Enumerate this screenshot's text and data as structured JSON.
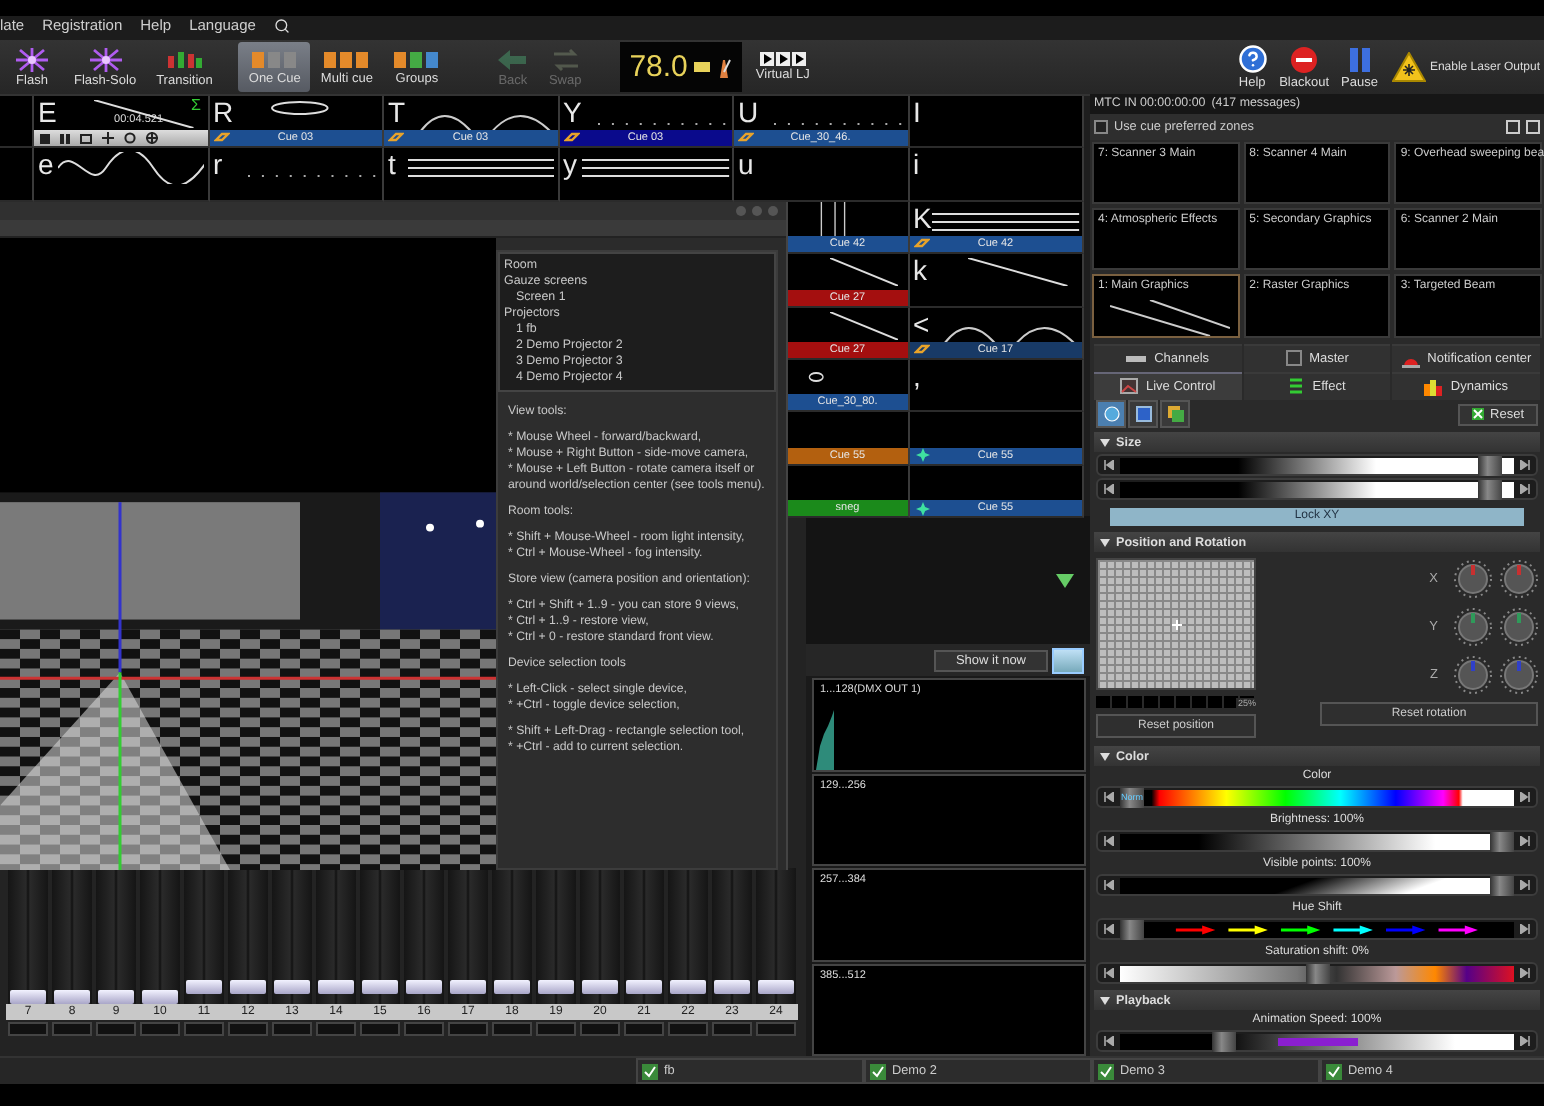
{
  "menu": [
    "late",
    "Registration",
    "Help",
    "Language"
  ],
  "toolbar": {
    "left": [
      {
        "label": "Flash",
        "kind": "flash",
        "selected": false,
        "disabled": false
      },
      {
        "label": "Flash-Solo",
        "kind": "flash-solo",
        "selected": false,
        "disabled": false
      },
      {
        "label": "Transition",
        "kind": "transition",
        "selected": false,
        "disabled": false
      },
      {
        "label": "One Cue",
        "kind": "one-cue",
        "selected": true,
        "disabled": false
      },
      {
        "label": "Multi cue",
        "kind": "multi-cue",
        "selected": false,
        "disabled": false
      },
      {
        "label": "Groups",
        "kind": "groups",
        "selected": false,
        "disabled": false
      },
      {
        "label": "Back",
        "kind": "back",
        "selected": false,
        "disabled": true
      },
      {
        "label": "Swap",
        "kind": "swap",
        "selected": false,
        "disabled": true
      }
    ],
    "bpm": "78.0",
    "virtual_lj": "Virtual LJ",
    "right": [
      {
        "label": "Help",
        "kind": "help"
      },
      {
        "label": "Blackout",
        "kind": "blackout"
      },
      {
        "label": "Pause",
        "kind": "pause"
      },
      {
        "label": "Enable Laser Output",
        "kind": "laser"
      }
    ]
  },
  "cue_rows": [
    {
      "cells": [
        {
          "kind": "none"
        },
        {
          "key": "E",
          "kind": "line",
          "playing": true,
          "time": "00:04.521",
          "sigma": "Σ"
        },
        {
          "key": "R",
          "kind": "ellipse",
          "cue": "Cue 03",
          "color": "#1d4f91",
          "linked": true
        },
        {
          "key": "T",
          "kind": "arc",
          "cue": "Cue 03",
          "color": "#1d4f91",
          "linked": true
        },
        {
          "key": "Y",
          "kind": "dots",
          "cue": "Cue 03",
          "color": "#0a0a8c",
          "linked": true
        },
        {
          "key": "U",
          "kind": "dots",
          "cue": "Cue_30_46.",
          "color": "#1d4f91",
          "linked": true
        },
        {
          "key": "I",
          "kind": "none"
        }
      ]
    },
    {
      "cells": [
        {
          "kind": "none"
        },
        {
          "key": "e",
          "kind": "wave"
        },
        {
          "key": "r",
          "kind": "dots"
        },
        {
          "key": "t",
          "kind": "lines"
        },
        {
          "key": "y",
          "kind": "lines"
        },
        {
          "key": "u",
          "kind": "none"
        },
        {
          "key": "i",
          "kind": "none"
        }
      ]
    },
    {
      "cells": [
        {
          "kind": "vlines",
          "cue": "Cue 42",
          "color": "#1d4f91"
        },
        {
          "key": "K",
          "kind": "lines",
          "cue": "Cue 42",
          "color": "#1d4f91",
          "linked": true
        }
      ]
    },
    {
      "cells": [
        {
          "kind": "line",
          "cue": "Cue 27",
          "color": "#a40f0f"
        },
        {
          "key": "k",
          "kind": "line"
        }
      ]
    },
    {
      "cells": [
        {
          "kind": "line",
          "cue": "Cue 27",
          "color": "#a40f0f"
        },
        {
          "key": "<",
          "kind": "arc",
          "cue": "Cue 17",
          "color": "#183a66",
          "linked": true
        }
      ]
    },
    {
      "cells": [
        {
          "kind": "spot",
          "cue": "Cue_30_80.",
          "color": "#1d4f91"
        },
        {
          "key": ",",
          "kind": "none"
        }
      ]
    },
    {
      "cells": [
        {
          "kind": "none",
          "cue": "Cue 55",
          "color": "#b3600f"
        },
        {
          "kind": "none",
          "cue": "Cue 55",
          "color": "#1d4f91",
          "starred": true
        }
      ]
    },
    {
      "cells": [
        {
          "kind": "none",
          "cue": "sneg",
          "color": "#1b8a1b"
        },
        {
          "kind": "none",
          "cue": "Cue 55",
          "color": "#1d4f91",
          "starred": true
        }
      ]
    }
  ],
  "visualizer": {
    "tree": [
      {
        "label": "Room"
      },
      {
        "label": "Gauze screens",
        "children": [
          {
            "label": "Screen 1"
          }
        ]
      },
      {
        "label": "Projectors",
        "children": [
          {
            "label": "1 fb"
          },
          {
            "label": "2 Demo Projector 2"
          },
          {
            "label": "3 Demo Projector 3"
          },
          {
            "label": "4 Demo Projector 4"
          }
        ]
      }
    ],
    "help": [
      {
        "kind": "heading",
        "text": "View tools:"
      },
      {
        "kind": "list",
        "lines": [
          "* Mouse Wheel - forward/backward,",
          "* Mouse + Right Button - side-move camera,",
          "* Mouse + Left Button - rotate camera itself or around world/selection center (see tools menu)."
        ]
      },
      {
        "kind": "heading",
        "text": "Room tools:"
      },
      {
        "kind": "list",
        "lines": [
          "* Shift + Mouse-Wheel - room light intensity,",
          "* Ctrl + Mouse-Wheel - fog intensity."
        ]
      },
      {
        "kind": "heading",
        "text": "Store view (camera position and orientation):"
      },
      {
        "kind": "list",
        "lines": [
          "* Ctrl + Shift + 1..9 - you can store 9 views,",
          "* Ctrl + 1..9 - restore view,",
          "* Ctrl + 0 - restore standard front view."
        ]
      },
      {
        "kind": "heading",
        "text": "Device selection tools"
      },
      {
        "kind": "list",
        "lines": [
          "* Left-Click - select single device,",
          "* +Ctrl - toggle device selection,"
        ]
      },
      {
        "kind": "list",
        "lines": [
          "* Shift + Left-Drag - rectangle selection tool,",
          "* +Ctrl - add to current selection."
        ]
      }
    ]
  },
  "faders": [
    {
      "label": "7",
      "level": 0
    },
    {
      "label": "8",
      "level": 0
    },
    {
      "label": "9",
      "level": 0
    },
    {
      "label": "10",
      "level": 0
    },
    {
      "label": "11",
      "level": 0.08
    },
    {
      "label": "12",
      "level": 0.08
    },
    {
      "label": "13",
      "level": 0.08
    },
    {
      "label": "14",
      "level": 0.08
    },
    {
      "label": "15",
      "level": 0.08
    },
    {
      "label": "16",
      "level": 0.08
    },
    {
      "label": "17",
      "level": 0.08
    },
    {
      "label": "18",
      "level": 0.08
    },
    {
      "label": "19",
      "level": 0.08
    },
    {
      "label": "20",
      "level": 0.08
    },
    {
      "label": "21",
      "level": 0.08
    },
    {
      "label": "22",
      "level": 0.08
    },
    {
      "label": "23",
      "level": 0.08
    },
    {
      "label": "24",
      "level": 0.08
    }
  ],
  "dmx": {
    "button": "Show it now",
    "universes": [
      {
        "label": "1...128(DMX OUT 1)",
        "active": true
      },
      {
        "label": "129...256",
        "active": false
      },
      {
        "label": "257...384",
        "active": false
      },
      {
        "label": "385...512",
        "active": false
      }
    ]
  },
  "right_panel": {
    "mtc": "MTC IN 00:00:00:00",
    "messages": "(417 messages)",
    "preferred_zones": {
      "label": "Use cue preferred zones",
      "checked": false
    },
    "zones": [
      {
        "label": "7: Scanner 3 Main",
        "selected": false
      },
      {
        "label": "8: Scanner 4 Main",
        "selected": false
      },
      {
        "label": "9: Overhead sweeping bea",
        "selected": false
      },
      {
        "label": "4: Atmospheric Effects",
        "selected": false
      },
      {
        "label": "5: Secondary Graphics",
        "selected": false
      },
      {
        "label": "6: Scanner 2 Main",
        "selected": false
      },
      {
        "label": "1: Main Graphics",
        "selected": true
      },
      {
        "label": "2: Raster Graphics",
        "selected": false
      },
      {
        "label": "3: Targeted Beam",
        "selected": false
      }
    ],
    "tab_rows": [
      [
        {
          "label": "Channels",
          "kind": "channels",
          "selected": false
        },
        {
          "label": "Master",
          "kind": "master",
          "selected": false
        },
        {
          "label": "Notification center",
          "kind": "notification",
          "selected": false
        }
      ],
      [
        {
          "label": "Live Control",
          "kind": "live",
          "selected": true
        },
        {
          "label": "Effect",
          "kind": "effect",
          "selected": false
        },
        {
          "label": "Dynamics",
          "kind": "dynamics",
          "selected": false
        }
      ]
    ],
    "tools": [
      {
        "kind": "globe",
        "selected": true
      },
      {
        "kind": "square",
        "selected": false
      },
      {
        "kind": "layers",
        "selected": false
      }
    ],
    "reset": "Reset",
    "size": {
      "title": "Size",
      "expanded": true,
      "sliders": [
        {
          "level": 0.97
        },
        {
          "level": 0.97
        }
      ],
      "lock": {
        "label": "Lock XY",
        "selected": true
      }
    },
    "position": {
      "title": "Position and Rotation",
      "expanded": true,
      "zoom": "25%",
      "axes": [
        {
          "label": "X",
          "color": "#c83030"
        },
        {
          "label": "Y",
          "color": "#2f9a5a"
        },
        {
          "label": "Z",
          "color": "#3040c8"
        }
      ],
      "reset_position": "Reset position",
      "reset_rotation": "Reset rotation"
    },
    "color": {
      "title": "Color",
      "expanded": true,
      "sliders": [
        {
          "label": "Color",
          "kind": "spectrum",
          "level": 0,
          "thumb": "Norm"
        },
        {
          "label": "Brightness: 100%",
          "kind": "gradient",
          "level": 1
        },
        {
          "label": "Visible points: 100%",
          "kind": "ramp",
          "level": 1
        },
        {
          "label": "Hue Shift",
          "kind": "hue",
          "level": 0
        },
        {
          "label": "Saturation shift: 0%",
          "kind": "saturation",
          "level": 0.5
        }
      ]
    },
    "playback": {
      "title": "Playback",
      "expanded": true,
      "sliders": [
        {
          "label": "Animation Speed: 100%",
          "kind": "speed",
          "level": 0.25
        }
      ]
    }
  },
  "devices": [
    {
      "label": "fb",
      "checked": true
    },
    {
      "label": "Demo 2",
      "checked": true
    },
    {
      "label": "Demo 3",
      "checked": true
    },
    {
      "label": "Demo 4",
      "checked": true
    }
  ]
}
